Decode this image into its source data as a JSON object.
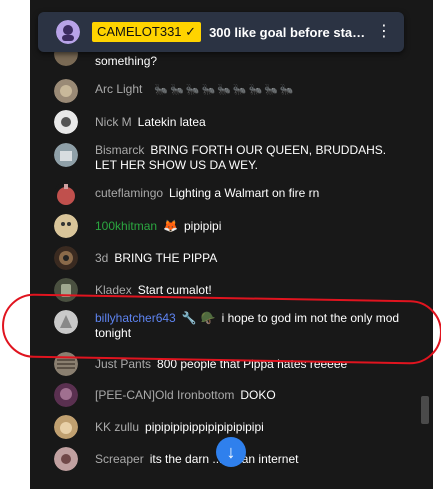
{
  "pinned": {
    "author": "CAMELOT331",
    "verified_mark": "✓",
    "text": "300 like goal before star…",
    "menu_icon": "more-vertical-icon"
  },
  "messages": [
    {
      "author": "",
      "text": "something?",
      "color": "#7a6a55"
    },
    {
      "author": "Arc Light",
      "text": "🐜🐜🐜🐜🐜🐜🐜🐜🐜",
      "color": "#9a8a76"
    },
    {
      "author": "Nick M",
      "text": "Latekin latea",
      "color": "#d8d8d8"
    },
    {
      "author": "Bismarck",
      "text": "BRING FORTH OUR QUEEN, BRUDDAHS. LET HER SHOW US DA WEY.",
      "color": "#8fa0a8"
    },
    {
      "author": "cuteflamingo",
      "text": "Lighting a Walmart on fire rn",
      "color": "#c0504d"
    },
    {
      "author": "100khitman",
      "text": "pipipipi",
      "color": "#d9c59a"
    },
    {
      "author": "3d",
      "text": "BRING THE PIPPA",
      "color": "#8a6a4a"
    },
    {
      "author": "Kladex",
      "text": "Start cumalot!",
      "color": "#6f7a5a"
    },
    {
      "author": "billyhatcher643",
      "text": "i hope to god im not the only mod tonight",
      "color": "#c9c9c9"
    },
    {
      "author": "Just Pants",
      "text": "800 people that Pippa hates reeeee",
      "color": "#8a7f70"
    },
    {
      "author": "[PEE-CAN]Old Ironbottom",
      "text": "DOKO",
      "color": "#8a5070"
    },
    {
      "author": "KK zullu",
      "text": "pipipipipippipipipipipipi",
      "color": "#c0a070"
    },
    {
      "author": "Screaper",
      "text": "its the darn ... adian internet",
      "color": "#c0a0a0"
    }
  ],
  "scroll_to_bottom": {
    "icon": "arrow-down-icon"
  }
}
